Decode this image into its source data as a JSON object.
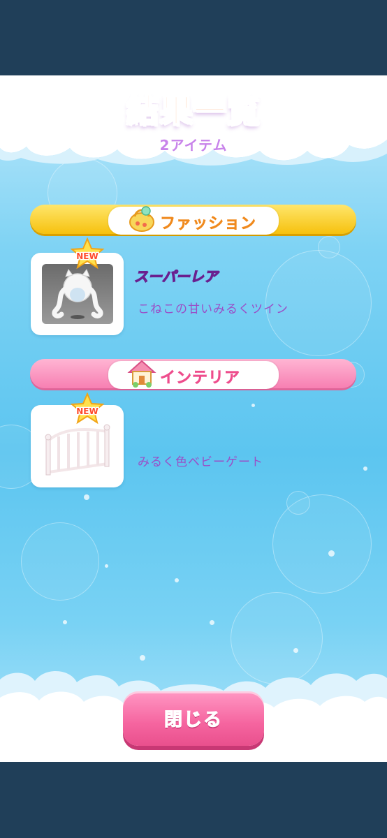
{
  "header": {
    "title": "結果一覧",
    "title_main": "結果一",
    "title_last": "覧",
    "count": "2アイテム"
  },
  "sections": [
    {
      "label": "ファッション",
      "color": "#f6c10e",
      "icon": "fashion-bag-icon",
      "items": [
        {
          "badge": "NEW",
          "rarity": "スーパーレア",
          "name": "こねこの甘いみるくツイン",
          "icon": "twin-tail-hair-icon"
        }
      ]
    },
    {
      "label": "インテリア",
      "color": "#f77fb2",
      "icon": "interior-house-icon",
      "items": [
        {
          "badge": "NEW",
          "rarity": "",
          "name": "みるく色ベビーゲート",
          "icon": "baby-gate-icon"
        }
      ]
    }
  ],
  "footer": {
    "close_label": "閉じる"
  },
  "colors": {
    "bar_bg": "#203f59",
    "accent_orange": "#ff9a56",
    "accent_purple": "#9a4fc7",
    "button_pink": "#f5649f"
  }
}
